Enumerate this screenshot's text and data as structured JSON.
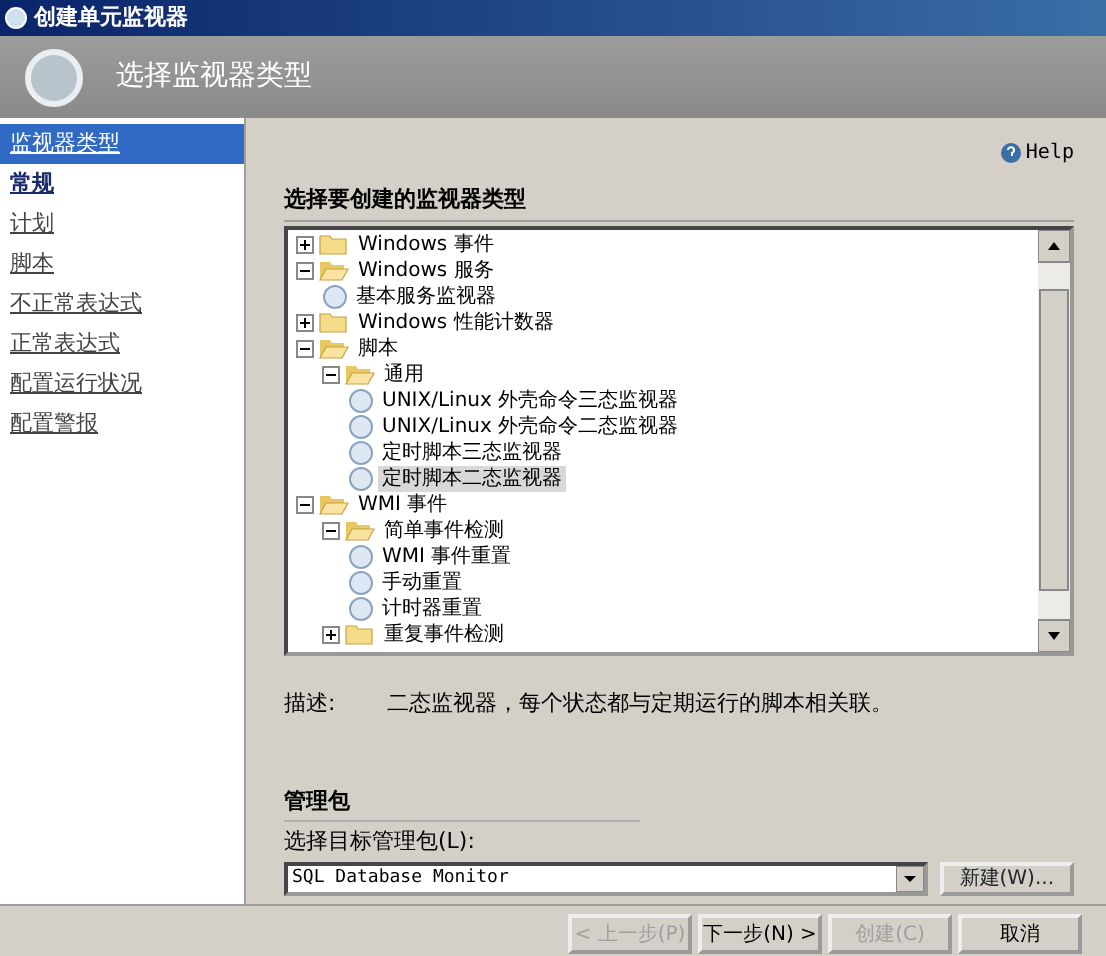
{
  "window": {
    "title": "创建单元监视器"
  },
  "header": {
    "title": "选择监视器类型"
  },
  "sidebar": {
    "items": [
      {
        "label": "监视器类型",
        "selected": true,
        "bold": false
      },
      {
        "label": "常规",
        "selected": false,
        "bold": true
      },
      {
        "label": "计划",
        "selected": false,
        "bold": false
      },
      {
        "label": "脚本",
        "selected": false,
        "bold": false
      },
      {
        "label": "不正常表达式",
        "selected": false,
        "bold": false
      },
      {
        "label": "正常表达式",
        "selected": false,
        "bold": false
      },
      {
        "label": "配置运行状况",
        "selected": false,
        "bold": false
      },
      {
        "label": "配置警报",
        "selected": false,
        "bold": false
      }
    ]
  },
  "help": {
    "label": "Help"
  },
  "tree_section": {
    "title": "选择要创建的监视器类型"
  },
  "tree": [
    {
      "kind": "folder",
      "label": "Windows 事件",
      "expanded": false,
      "selected": false
    },
    {
      "kind": "folder",
      "label": "Windows 服务",
      "expanded": true,
      "selected": false,
      "children": [
        {
          "kind": "monitor",
          "label": "基本服务监视器",
          "selected": false
        }
      ]
    },
    {
      "kind": "folder",
      "label": "Windows 性能计数器",
      "expanded": false,
      "selected": false
    },
    {
      "kind": "folder",
      "label": "脚本",
      "expanded": true,
      "selected": false,
      "children": [
        {
          "kind": "folder",
          "label": "通用",
          "expanded": true,
          "selected": false,
          "children": [
            {
              "kind": "monitor",
              "label": "UNIX/Linux 外壳命令三态监视器",
              "selected": false
            },
            {
              "kind": "monitor",
              "label": "UNIX/Linux 外壳命令二态监视器",
              "selected": false
            },
            {
              "kind": "monitor",
              "label": "定时脚本三态监视器",
              "selected": false
            },
            {
              "kind": "monitor",
              "label": "定时脚本二态监视器",
              "selected": true
            }
          ]
        }
      ]
    },
    {
      "kind": "folder",
      "label": "WMI 事件",
      "expanded": true,
      "selected": false,
      "children": [
        {
          "kind": "folder",
          "label": "简单事件检测",
          "expanded": true,
          "selected": false,
          "children": [
            {
              "kind": "monitor",
              "label": "WMI 事件重置",
              "selected": false
            },
            {
              "kind": "monitor",
              "label": "手动重置",
              "selected": false
            },
            {
              "kind": "monitor",
              "label": "计时器重置",
              "selected": false
            }
          ]
        },
        {
          "kind": "folder",
          "label": "重复事件检测",
          "expanded": false,
          "selected": false
        }
      ]
    }
  ],
  "description": {
    "label": "描述:",
    "text": "二态监视器，每个状态都与定期运行的脚本相关联。"
  },
  "management_pack": {
    "title": "管理包",
    "field_label": "选择目标管理包(L):",
    "value": "SQL Database Monitor",
    "new_button": "新建(W)..."
  },
  "buttons": [
    {
      "label": "< 上一步(P)",
      "disabled": true
    },
    {
      "label": "下一步(N) >",
      "disabled": false
    },
    {
      "label": "创建(C)",
      "disabled": true
    },
    {
      "label": "取消",
      "disabled": false
    }
  ]
}
